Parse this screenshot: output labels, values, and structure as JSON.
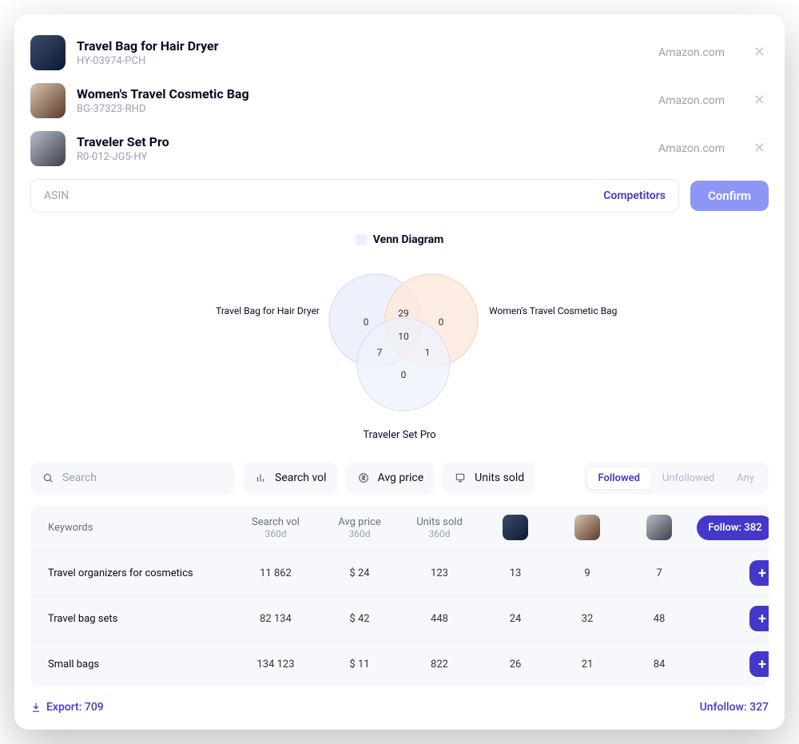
{
  "products": [
    {
      "title": "Travel Bag for Hair Dryer",
      "sku": "HY-03974-PCH",
      "marketplace": "Amazon.com"
    },
    {
      "title": "Women's Travel Cosmetic Bag",
      "sku": "BG-37323-RHD",
      "marketplace": "Amazon.com"
    },
    {
      "title": "Traveler Set Pro",
      "sku": "R0-012-JG5-HY",
      "marketplace": "Amazon.com"
    }
  ],
  "asin_bar": {
    "placeholder": "ASIN",
    "competitors": "Competitors",
    "confirm": "Confirm"
  },
  "venn": {
    "legend": "Venn Diagram",
    "label_left": "Travel Bag for Hair Dryer",
    "label_right": "Women's Travel Cosmetic Bag",
    "label_bottom": "Traveler Set Pro"
  },
  "chart_data": {
    "type": "venn",
    "sets": [
      {
        "name": "Travel Bag for Hair Dryer",
        "only": 0
      },
      {
        "name": "Women's Travel Cosmetic Bag",
        "only": 0
      },
      {
        "name": "Traveler Set Pro",
        "only": 0
      }
    ],
    "pair_AB": 29,
    "pair_AC": 7,
    "pair_BC": 1,
    "triple": 10
  },
  "filters": {
    "search_placeholder": "Search",
    "search_vol": "Search vol",
    "avg_price": "Avg price",
    "units_sold": "Units sold",
    "seg": [
      "Followed",
      "Unfollowed",
      "Any"
    ]
  },
  "table": {
    "headers": {
      "keywords": "Keywords",
      "search_vol": "Search vol",
      "search_vol_sub": "360d",
      "avg_price": "Avg price",
      "avg_price_sub": "360d",
      "units_sold": "Units sold",
      "units_sold_sub": "360d",
      "follow_btn": "Follow: 382"
    },
    "rows": [
      {
        "kw": "Travel organizers for cosmetics",
        "sv": "11 862",
        "price": "$ 24",
        "units": "123",
        "c1": "13",
        "c2": "9",
        "c3": "7"
      },
      {
        "kw": "Travel bag sets",
        "sv": "82 134",
        "price": "$ 42",
        "units": "448",
        "c1": "24",
        "c2": "32",
        "c3": "48"
      },
      {
        "kw": "Small bags",
        "sv": "134 123",
        "price": "$ 11",
        "units": "822",
        "c1": "26",
        "c2": "21",
        "c3": "84"
      }
    ]
  },
  "footer": {
    "export": "Export: 709",
    "unfollow": "Unfollow: 327"
  }
}
